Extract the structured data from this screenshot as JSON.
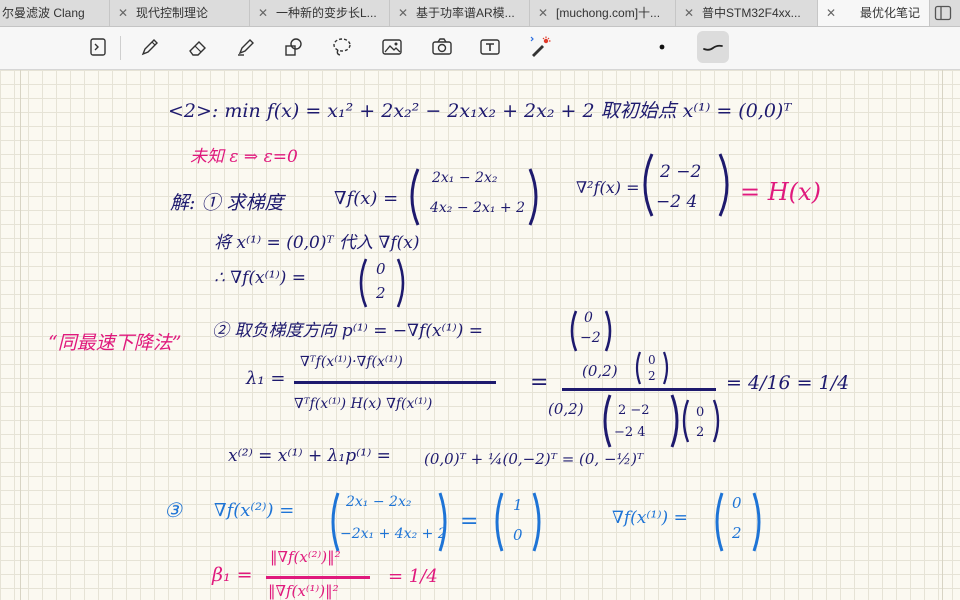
{
  "tabs": [
    {
      "label": "尔曼滤波 Clang",
      "active": false
    },
    {
      "label": "现代控制理论",
      "active": false
    },
    {
      "label": "一种新的变步长L...",
      "active": false
    },
    {
      "label": "基于功率谱AR模...",
      "active": false
    },
    {
      "label": "[muchong.com]十...",
      "active": false
    },
    {
      "label": "普中STM32F4xx...",
      "active": false
    },
    {
      "label": "最优化笔记",
      "active": true
    }
  ],
  "toolbar": {
    "tools": [
      "page-thumbnails-icon",
      "pen-icon",
      "eraser-icon",
      "highlighter-icon",
      "shapes-icon",
      "lasso-icon",
      "image-icon",
      "camera-icon",
      "text-box-icon",
      "laser-pointer-icon",
      "pen-size-dot-icon",
      "stroke-style-icon"
    ],
    "selected": "stroke-style-icon"
  },
  "colors": {
    "ink": "#1e1a6e",
    "magenta": "#e0197d",
    "blue": "#1e74d6",
    "paper": "#fbf9f1"
  },
  "notes": {
    "problem": "<2>: min f(x) = x₁² + 2x₂² − 2x₁x₂ + 2x₂ + 2   取初始点 x⁽¹⁾ = (0,0)ᵀ",
    "given": "未知 ε ⇒ ε=0",
    "solve_label": "解: ① 求梯度",
    "gradient_expr": "∇f(x) =",
    "gradient_top": "2x₁ − 2x₂",
    "gradient_bot": "4x₂ − 2x₁ + 2",
    "hessian_expr": "∇²f(x) =",
    "hessian_r1": "2  −2",
    "hessian_r2": "−2  4",
    "hessian_eq": "= H(x)",
    "substitute": "将 x⁽¹⁾ = (0,0)ᵀ 代入 ∇f(x)",
    "grad1_expr": "∴ ∇f(x⁽¹⁾) =",
    "grad1_top": "0",
    "grad1_bot": "2",
    "step2": "② 取负梯度方向  p⁽¹⁾ = −∇f(x⁽¹⁾) =",
    "p1_top": "0",
    "p1_bot": "−2",
    "side_note": "“同最速下降法”",
    "lambda_lhs": "λ₁ =",
    "lambda_num": "∇ᵀf(x⁽¹⁾)·∇f(x⁽¹⁾)",
    "lambda_den": "∇ᵀf(x⁽¹⁾) H(x) ∇f(x⁽¹⁾)",
    "lambda_eq": "=",
    "lambda_num2": "(0,2)",
    "lambda_den2": "(0,2)",
    "lambda_res": "= 4/16 = 1/4",
    "x2_expr": "x⁽²⁾ = x⁽¹⁾ + λ₁p⁽¹⁾ =",
    "x2_rhs": "(0,0)ᵀ + ¼(0,−2)ᵀ = (0, −½)ᵀ",
    "step3_num": "③",
    "grad2_expr": "∇f(x⁽²⁾) =",
    "grad2_top": "2x₁ − 2x₂",
    "grad2_bot": "−2x₁ + 4x₂ + 2",
    "grad2_res_top": "1",
    "grad2_res_bot": "0",
    "grad1_again": "∇f(x⁽¹⁾) =",
    "grad1_again_top": "0",
    "grad1_again_bot": "2",
    "beta_lhs": "β₁ =",
    "beta_num": "‖∇f(x⁽²⁾)‖²",
    "beta_den": "‖∇f(x⁽¹⁾)‖²",
    "beta_res": "= 1/4"
  }
}
